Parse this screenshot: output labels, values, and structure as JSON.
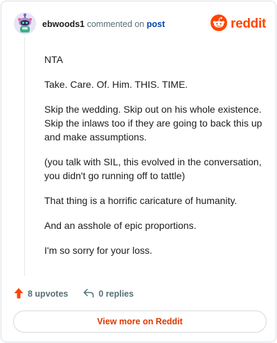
{
  "header": {
    "username": "ebwoods1",
    "action_text": "commented on",
    "post_link": "post",
    "brand_name": "reddit"
  },
  "comment": {
    "paragraphs": [
      "NTA",
      "Take. Care. Of. Him. THIS. TIME.",
      "Skip the wedding. Skip out on his whole existence. Skip the inlaws too if they are going to back this up and make assumptions.",
      "(you talk with SIL, this evolved in the conversation, you didn't go running off to tattle)",
      "That thing is a horrific caricature of humanity.",
      "And an asshole of epic proportions.",
      "I'm so sorry for your loss."
    ]
  },
  "actions": {
    "upvotes_label": "8 upvotes",
    "replies_label": "0 replies"
  },
  "footer": {
    "view_more_label": "View more on Reddit"
  },
  "colors": {
    "brand": "#ff4500",
    "link": "#0045ac",
    "muted": "#576f76",
    "cta": "#d93900"
  },
  "icons": {
    "avatar": "snoo-avatar-icon",
    "logo": "reddit-logo-icon",
    "upvote": "upvote-arrow-icon",
    "reply": "reply-arrow-icon"
  }
}
